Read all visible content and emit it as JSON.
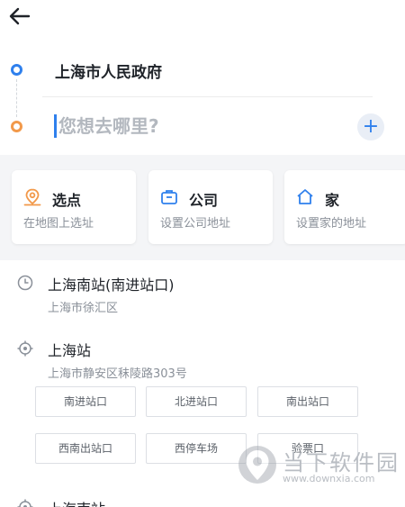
{
  "route": {
    "from": "上海市人民政府",
    "to_placeholder": "您想去哪里?",
    "add_label": "+"
  },
  "shortcuts": [
    {
      "title": "选点",
      "subtitle": "在地图上选址",
      "icon": "map-pin-icon"
    },
    {
      "title": "公司",
      "subtitle": "设置公司地址",
      "icon": "briefcase-icon"
    },
    {
      "title": "家",
      "subtitle": "设置家的地址",
      "icon": "home-icon"
    }
  ],
  "history": [
    {
      "title": "上海南站(南进站口)",
      "subtitle": "上海市徐汇区",
      "icon": "clock-icon"
    },
    {
      "title": "上海站",
      "subtitle": "上海市静安区秣陵路303号",
      "icon": "location-target-icon",
      "entrances": [
        "南进站口",
        "北进站口",
        "南出站口",
        "西南出站口",
        "西停车场",
        "验票口"
      ]
    },
    {
      "title": "上海南站",
      "icon": "location-target-icon"
    }
  ],
  "watermark": {
    "text": "当下软件园",
    "url": "www.downxia.com"
  },
  "colors": {
    "accent": "#2f80ed",
    "origin": "#2f80ed",
    "destination": "#f2994a",
    "pick_icon": "#f2994a"
  }
}
